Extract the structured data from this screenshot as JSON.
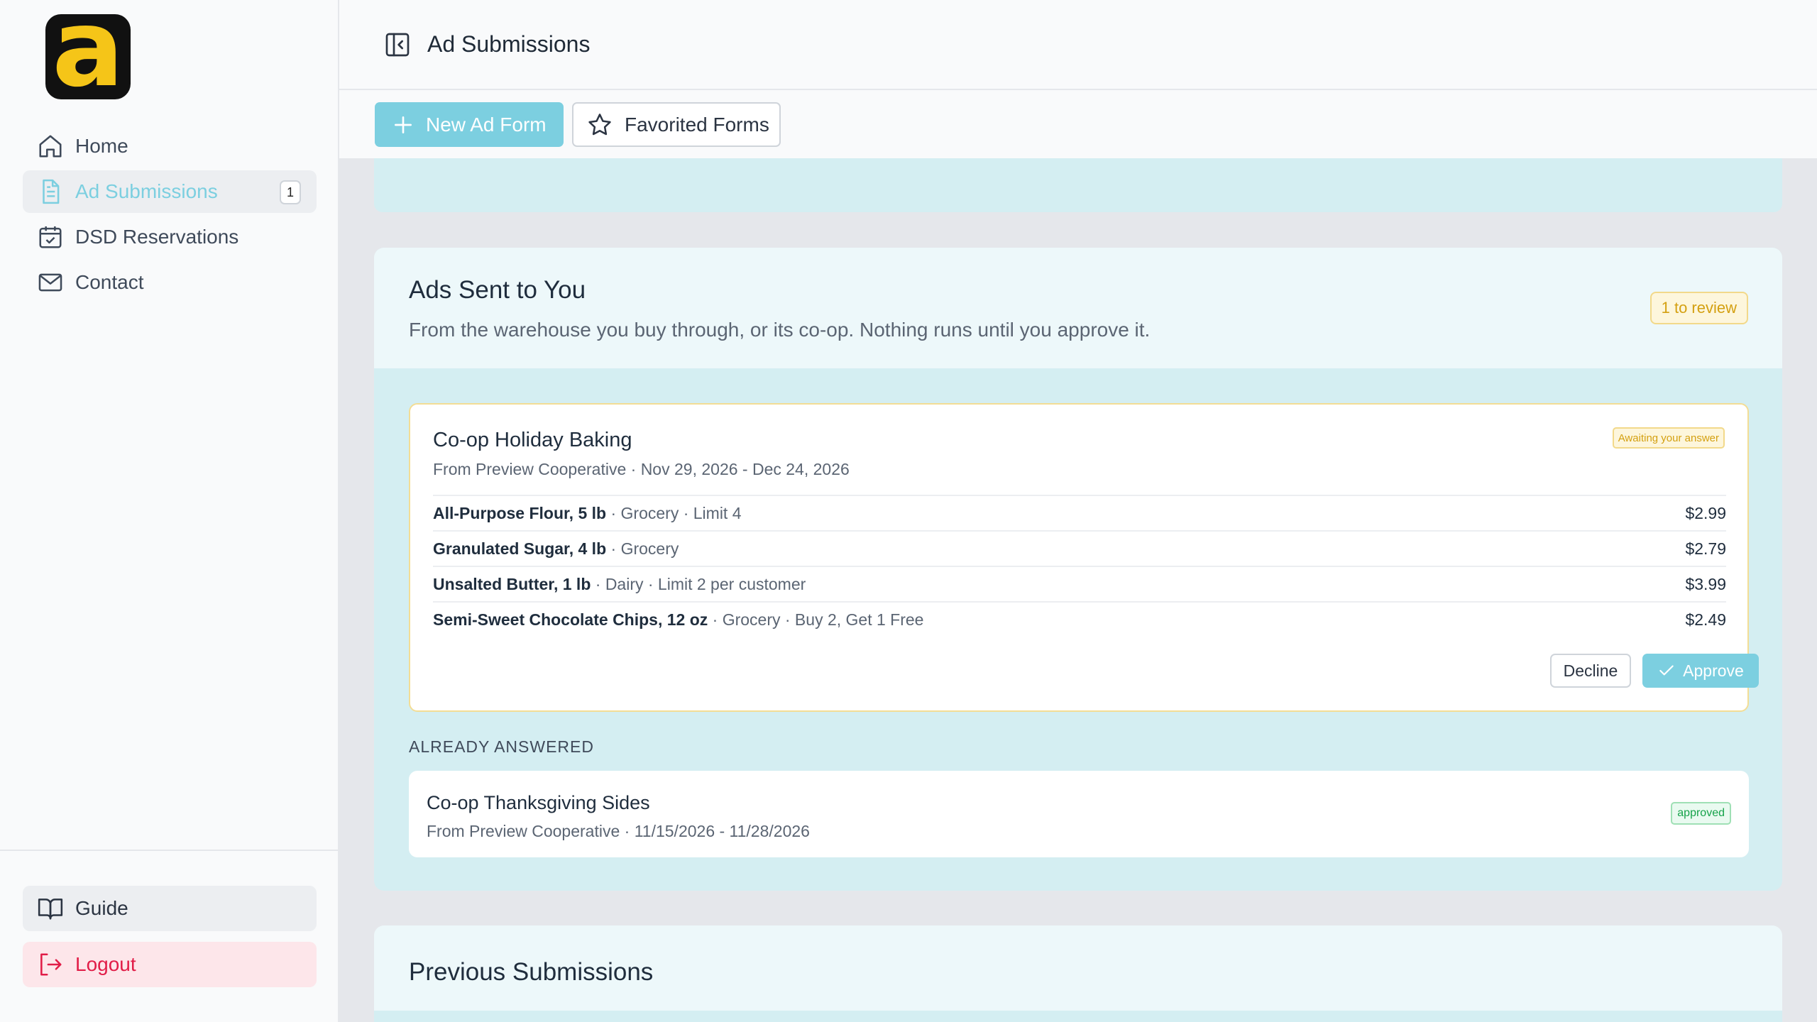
{
  "logo": {
    "letter": "a"
  },
  "sidebar": {
    "items": [
      {
        "label": "Home",
        "icon": "home-icon"
      },
      {
        "label": "Ad Submissions",
        "icon": "document-icon",
        "badge": "1",
        "active": true
      },
      {
        "label": "DSD Reservations",
        "icon": "calendar-check-icon"
      },
      {
        "label": "Contact",
        "icon": "mail-icon"
      }
    ],
    "guide_label": "Guide",
    "logout_label": "Logout"
  },
  "header": {
    "title": "Ad Submissions"
  },
  "toolbar": {
    "new_label": "New Ad Form",
    "favorited_label": "Favorited Forms"
  },
  "ads_sent": {
    "title": "Ads Sent to You",
    "subtitle": "From the warehouse you buy through, or its co-op. Nothing runs until you approve it.",
    "review_badge": "1 to review",
    "pending": {
      "title": "Co-op Holiday Baking",
      "subtitle": "From Preview Cooperative · Nov 29, 2026 - Dec 24, 2026",
      "status": "Awaiting your answer",
      "items": [
        {
          "name": "All-Purpose Flour, 5 lb",
          "details": " · Grocery · Limit 4",
          "price": "$2.99"
        },
        {
          "name": "Granulated Sugar, 4 lb",
          "details": " · Grocery",
          "price": "$2.79"
        },
        {
          "name": "Unsalted Butter, 1 lb",
          "details": " · Dairy · Limit 2 per customer",
          "price": "$3.99"
        },
        {
          "name": "Semi-Sweet Chocolate Chips, 12 oz",
          "details": " · Grocery · Buy 2, Get 1 Free",
          "price": "$2.49"
        }
      ],
      "decline_label": "Decline",
      "approve_label": "Approve"
    },
    "answered_heading": "ALREADY ANSWERED",
    "answered": {
      "title": "Co-op Thanksgiving Sides",
      "subtitle": "From Preview Cooperative · 11/15/2026 - 11/28/2026",
      "status": "approved"
    }
  },
  "previous": {
    "title": "Previous Submissions"
  },
  "colors": {
    "accent": "#7ccfe0",
    "warning": "#d4a011",
    "success": "#16a34a",
    "danger": "#e11d48"
  }
}
